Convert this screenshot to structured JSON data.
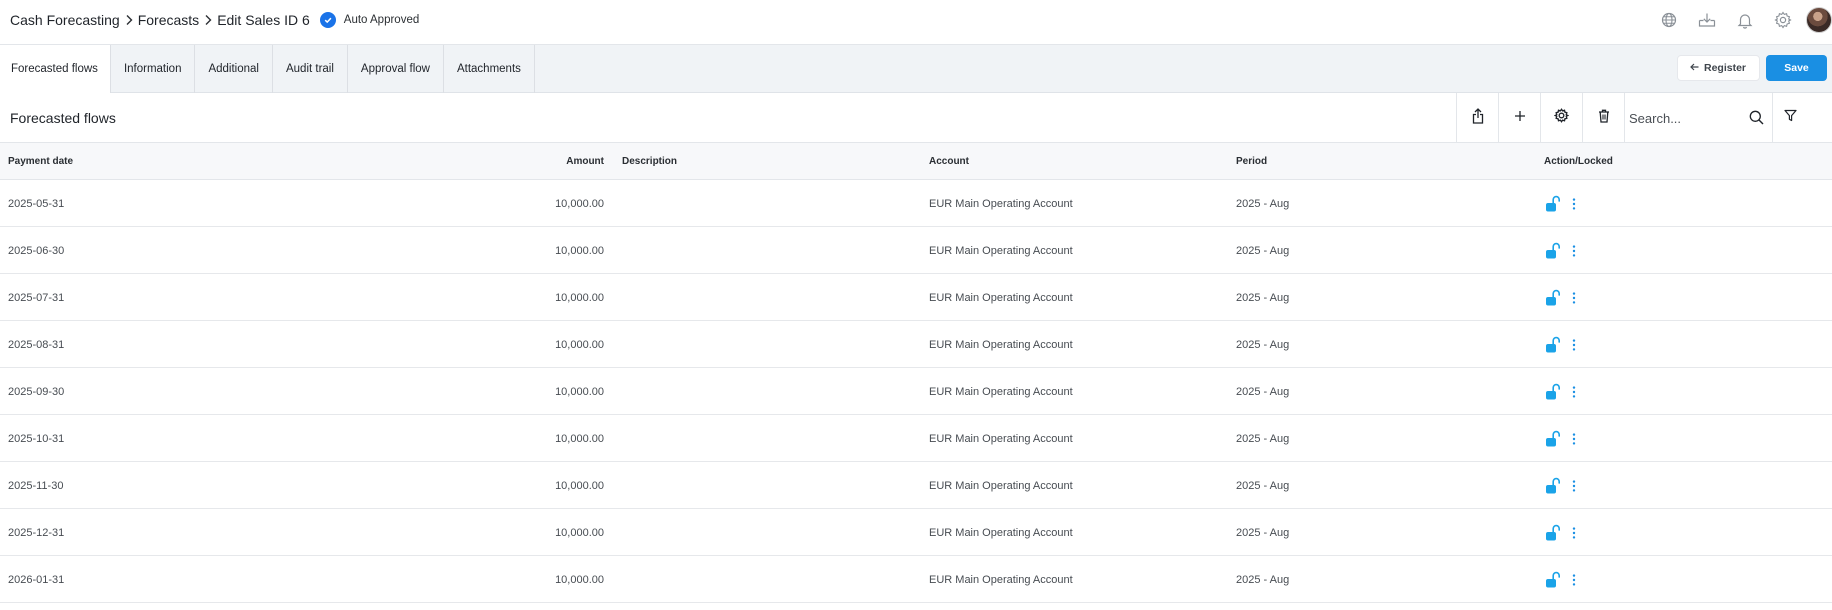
{
  "breadcrumb": {
    "items": [
      "Cash Forecasting",
      "Forecasts",
      "Edit Sales ID 6"
    ],
    "status_label": "Auto Approved"
  },
  "top_icons": [
    "globe-icon",
    "download-tray-icon",
    "bell-icon",
    "gear-icon",
    "avatar"
  ],
  "tabs": [
    {
      "label": "Forecasted flows",
      "active": true
    },
    {
      "label": "Information",
      "active": false
    },
    {
      "label": "Additional",
      "active": false
    },
    {
      "label": "Audit trail",
      "active": false
    },
    {
      "label": "Approval flow",
      "active": false
    },
    {
      "label": "Attachments",
      "active": false
    }
  ],
  "actions": {
    "register_label": "Register",
    "save_label": "Save"
  },
  "section": {
    "title": "Forecasted flows",
    "search_placeholder": "Search..."
  },
  "table": {
    "headers": {
      "payment_date": "Payment date",
      "amount": "Amount",
      "description": "Description",
      "account": "Account",
      "period": "Period",
      "action": "Action/Locked"
    },
    "rows": [
      {
        "date": "2025-05-31",
        "amount": "10,000.00",
        "description": "",
        "account": "EUR Main Operating Account",
        "period": "2025 - Aug"
      },
      {
        "date": "2025-06-30",
        "amount": "10,000.00",
        "description": "",
        "account": "EUR Main Operating Account",
        "period": "2025 - Aug"
      },
      {
        "date": "2025-07-31",
        "amount": "10,000.00",
        "description": "",
        "account": "EUR Main Operating Account",
        "period": "2025 - Aug"
      },
      {
        "date": "2025-08-31",
        "amount": "10,000.00",
        "description": "",
        "account": "EUR Main Operating Account",
        "period": "2025 - Aug"
      },
      {
        "date": "2025-09-30",
        "amount": "10,000.00",
        "description": "",
        "account": "EUR Main Operating Account",
        "period": "2025 - Aug"
      },
      {
        "date": "2025-10-31",
        "amount": "10,000.00",
        "description": "",
        "account": "EUR Main Operating Account",
        "period": "2025 - Aug"
      },
      {
        "date": "2025-11-30",
        "amount": "10,000.00",
        "description": "",
        "account": "EUR Main Operating Account",
        "period": "2025 - Aug"
      },
      {
        "date": "2025-12-31",
        "amount": "10,000.00",
        "description": "",
        "account": "EUR Main Operating Account",
        "period": "2025 - Aug"
      },
      {
        "date": "2026-01-31",
        "amount": "10,000.00",
        "description": "",
        "account": "EUR Main Operating Account",
        "period": "2025 - Aug"
      }
    ]
  },
  "colors": {
    "accent": "#1a8fe3",
    "status_check": "#1a73e8",
    "lock_icon": "#1aa3e8",
    "tab_bar_bg": "#f0f3f6"
  }
}
